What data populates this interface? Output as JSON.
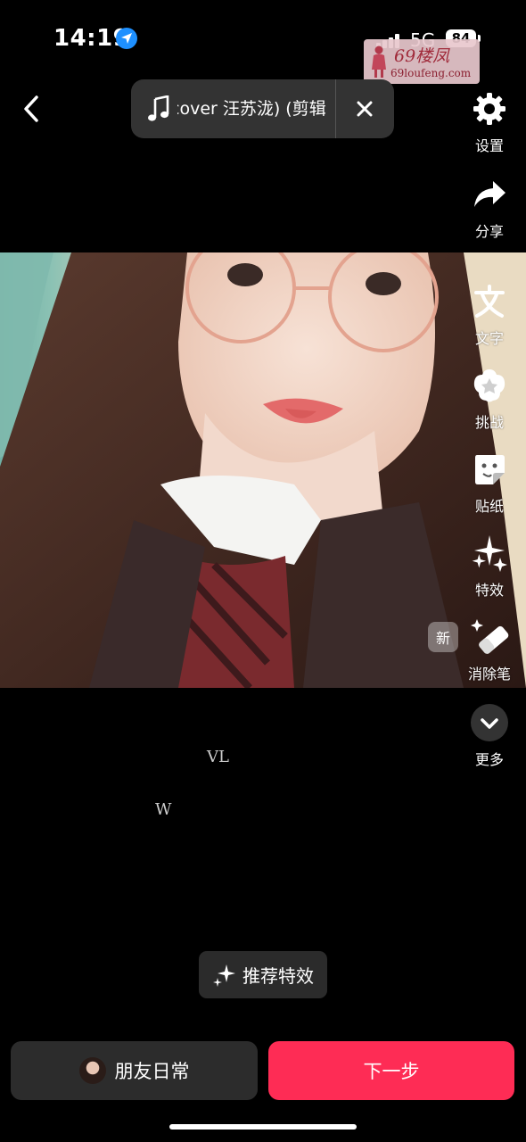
{
  "status_bar": {
    "time": "14:19",
    "network": "5G",
    "battery": "84"
  },
  "watermark": {
    "brand": "69楼凤",
    "url": "69loufeng.com"
  },
  "music": {
    "title": "cover 汪苏泷) (剪辑"
  },
  "toolbar": {
    "settings": "设置",
    "share": "分享",
    "text": "文字",
    "challenge": "挑战",
    "sticker": "贴纸",
    "effects": "特效",
    "eraser": "消除笔",
    "more": "更多",
    "new_badge": "新"
  },
  "overlay_text": {
    "vl": "VL",
    "w": "W"
  },
  "recommend_effects": "推荐特效",
  "bottom": {
    "friends": "朋友日常",
    "next": "下一步"
  },
  "colors": {
    "accent": "#fe2c55",
    "pill": "#333333"
  }
}
